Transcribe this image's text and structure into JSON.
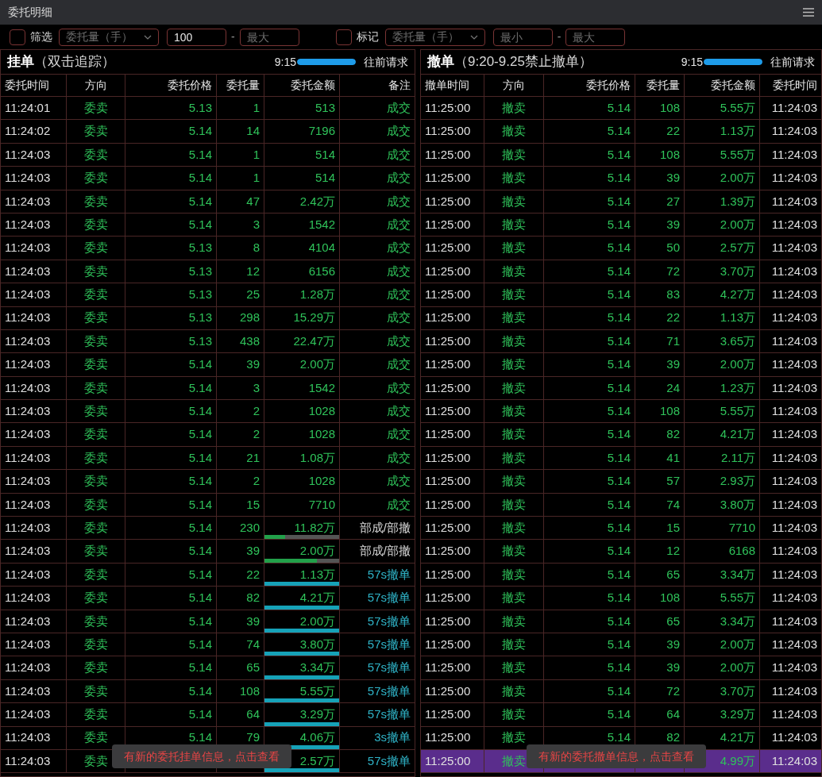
{
  "window": {
    "title": "委托明细"
  },
  "filters": [
    {
      "label": "筛选",
      "checked": false,
      "dropdown": "委托量（手）",
      "min": {
        "value": "100"
      },
      "separator": "-",
      "max": {
        "placeholder": "最大"
      }
    },
    {
      "label": "标记",
      "checked": false,
      "dropdown": "委托量（手）",
      "min": {
        "placeholder": "最小"
      },
      "separator": "-",
      "max": {
        "placeholder": "最大"
      }
    }
  ],
  "panels": [
    {
      "title": "挂单",
      "subtitle": "（双击追踪）",
      "time": "9:15",
      "level": 1,
      "request": "往前请求",
      "columns": [
        "委托时间",
        "方向",
        "委托价格",
        "委托量",
        "委托金额",
        "备注"
      ],
      "toast": "有新的委托挂单信息，点击查看",
      "rows": [
        {
          "cells": [
            "11:24:01",
            "委卖",
            "5.13",
            "1",
            "513",
            "成交"
          ],
          "kind": "filled",
          "selected": false
        },
        {
          "cells": [
            "11:24:02",
            "委卖",
            "5.14",
            "14",
            "7196",
            "成交"
          ],
          "kind": "filled",
          "selected": false
        },
        {
          "cells": [
            "11:24:03",
            "委卖",
            "5.14",
            "1",
            "514",
            "成交"
          ],
          "kind": "filled",
          "selected": false
        },
        {
          "cells": [
            "11:24:03",
            "委卖",
            "5.14",
            "1",
            "514",
            "成交"
          ],
          "kind": "filled",
          "selected": false
        },
        {
          "cells": [
            "11:24:03",
            "委卖",
            "5.14",
            "47",
            "2.42万",
            "成交"
          ],
          "kind": "filled",
          "selected": false
        },
        {
          "cells": [
            "11:24:03",
            "委卖",
            "5.14",
            "3",
            "1542",
            "成交"
          ],
          "kind": "filled",
          "selected": false
        },
        {
          "cells": [
            "11:24:03",
            "委卖",
            "5.13",
            "8",
            "4104",
            "成交"
          ],
          "kind": "filled",
          "selected": false
        },
        {
          "cells": [
            "11:24:03",
            "委卖",
            "5.13",
            "12",
            "6156",
            "成交"
          ],
          "kind": "filled",
          "selected": false
        },
        {
          "cells": [
            "11:24:03",
            "委卖",
            "5.13",
            "25",
            "1.28万",
            "成交"
          ],
          "kind": "filled",
          "selected": false
        },
        {
          "cells": [
            "11:24:03",
            "委卖",
            "5.13",
            "298",
            "15.29万",
            "成交"
          ],
          "kind": "filled",
          "selected": false
        },
        {
          "cells": [
            "11:24:03",
            "委卖",
            "5.13",
            "438",
            "22.47万",
            "成交"
          ],
          "kind": "filled",
          "selected": false
        },
        {
          "cells": [
            "11:24:03",
            "委卖",
            "5.14",
            "39",
            "2.00万",
            "成交"
          ],
          "kind": "filled",
          "selected": false
        },
        {
          "cells": [
            "11:24:03",
            "委卖",
            "5.14",
            "3",
            "1542",
            "成交"
          ],
          "kind": "filled",
          "selected": false
        },
        {
          "cells": [
            "11:24:03",
            "委卖",
            "5.14",
            "2",
            "1028",
            "成交"
          ],
          "kind": "filled",
          "selected": false
        },
        {
          "cells": [
            "11:24:03",
            "委卖",
            "5.14",
            "2",
            "1028",
            "成交"
          ],
          "kind": "filled",
          "selected": false
        },
        {
          "cells": [
            "11:24:03",
            "委卖",
            "5.14",
            "21",
            "1.08万",
            "成交"
          ],
          "kind": "filled",
          "selected": false
        },
        {
          "cells": [
            "11:24:03",
            "委卖",
            "5.14",
            "2",
            "1028",
            "成交"
          ],
          "kind": "filled",
          "selected": false
        },
        {
          "cells": [
            "11:24:03",
            "委卖",
            "5.14",
            "15",
            "7710",
            "成交"
          ],
          "kind": "filled",
          "selected": false
        },
        {
          "cells": [
            "11:24:03",
            "委卖",
            "5.14",
            "230",
            "11.82万",
            "部成/部撤"
          ],
          "kind": "partial",
          "level": 0.28,
          "selected": false
        },
        {
          "cells": [
            "11:24:03",
            "委卖",
            "5.14",
            "39",
            "2.00万",
            "部成/部撤"
          ],
          "kind": "partial",
          "level": 0.7,
          "selected": false
        },
        {
          "cells": [
            "11:24:03",
            "委卖",
            "5.14",
            "22",
            "1.13万",
            "57s撤单"
          ],
          "kind": "cancel",
          "level": 1,
          "selected": false
        },
        {
          "cells": [
            "11:24:03",
            "委卖",
            "5.14",
            "82",
            "4.21万",
            "57s撤单"
          ],
          "kind": "cancel",
          "level": 1,
          "selected": false
        },
        {
          "cells": [
            "11:24:03",
            "委卖",
            "5.14",
            "39",
            "2.00万",
            "57s撤单"
          ],
          "kind": "cancel",
          "level": 1,
          "selected": false
        },
        {
          "cells": [
            "11:24:03",
            "委卖",
            "5.14",
            "74",
            "3.80万",
            "57s撤单"
          ],
          "kind": "cancel",
          "level": 1,
          "selected": false
        },
        {
          "cells": [
            "11:24:03",
            "委卖",
            "5.14",
            "65",
            "3.34万",
            "57s撤单"
          ],
          "kind": "cancel",
          "level": 1,
          "selected": false
        },
        {
          "cells": [
            "11:24:03",
            "委卖",
            "5.14",
            "108",
            "5.55万",
            "57s撤单"
          ],
          "kind": "cancel",
          "level": 1,
          "selected": false
        },
        {
          "cells": [
            "11:24:03",
            "委卖",
            "5.14",
            "64",
            "3.29万",
            "57s撤单"
          ],
          "kind": "cancel",
          "level": 1,
          "selected": false
        },
        {
          "cells": [
            "11:24:03",
            "委卖",
            "5.14",
            "79",
            "4.06万",
            "3s撤单"
          ],
          "kind": "cancel",
          "level": 1,
          "selected": false
        },
        {
          "cells": [
            "11:24:03",
            "委卖",
            null,
            null,
            "2.57万",
            "57s撤单"
          ],
          "kind": "cancel",
          "level": 1,
          "selected": false
        }
      ]
    },
    {
      "title": "撤单",
      "subtitle": "（9:20-9.25禁止撤单）",
      "time": "9:15",
      "level": 1,
      "request": "往前请求",
      "columns": [
        "撤单时间",
        "方向",
        "委托价格",
        "委托量",
        "委托金额",
        "委托时间"
      ],
      "toast": "有新的委托撤单信息，点击查看",
      "rows": [
        {
          "cells": [
            "11:25:00",
            "撤卖",
            "5.14",
            "108",
            "5.55万",
            "11:24:03"
          ],
          "selected": false
        },
        {
          "cells": [
            "11:25:00",
            "撤卖",
            "5.14",
            "22",
            "1.13万",
            "11:24:03"
          ],
          "selected": false
        },
        {
          "cells": [
            "11:25:00",
            "撤卖",
            "5.14",
            "108",
            "5.55万",
            "11:24:03"
          ],
          "selected": false
        },
        {
          "cells": [
            "11:25:00",
            "撤卖",
            "5.14",
            "39",
            "2.00万",
            "11:24:03"
          ],
          "selected": false
        },
        {
          "cells": [
            "11:25:00",
            "撤卖",
            "5.14",
            "27",
            "1.39万",
            "11:24:03"
          ],
          "selected": false
        },
        {
          "cells": [
            "11:25:00",
            "撤卖",
            "5.14",
            "39",
            "2.00万",
            "11:24:03"
          ],
          "selected": false
        },
        {
          "cells": [
            "11:25:00",
            "撤卖",
            "5.14",
            "50",
            "2.57万",
            "11:24:03"
          ],
          "selected": false
        },
        {
          "cells": [
            "11:25:00",
            "撤卖",
            "5.14",
            "72",
            "3.70万",
            "11:24:03"
          ],
          "selected": false
        },
        {
          "cells": [
            "11:25:00",
            "撤卖",
            "5.14",
            "83",
            "4.27万",
            "11:24:03"
          ],
          "selected": false
        },
        {
          "cells": [
            "11:25:00",
            "撤卖",
            "5.14",
            "22",
            "1.13万",
            "11:24:03"
          ],
          "selected": false
        },
        {
          "cells": [
            "11:25:00",
            "撤卖",
            "5.14",
            "71",
            "3.65万",
            "11:24:03"
          ],
          "selected": false
        },
        {
          "cells": [
            "11:25:00",
            "撤卖",
            "5.14",
            "39",
            "2.00万",
            "11:24:03"
          ],
          "selected": false
        },
        {
          "cells": [
            "11:25:00",
            "撤卖",
            "5.14",
            "24",
            "1.23万",
            "11:24:03"
          ],
          "selected": false
        },
        {
          "cells": [
            "11:25:00",
            "撤卖",
            "5.14",
            "108",
            "5.55万",
            "11:24:03"
          ],
          "selected": false
        },
        {
          "cells": [
            "11:25:00",
            "撤卖",
            "5.14",
            "82",
            "4.21万",
            "11:24:03"
          ],
          "selected": false
        },
        {
          "cells": [
            "11:25:00",
            "撤卖",
            "5.14",
            "41",
            "2.11万",
            "11:24:03"
          ],
          "selected": false
        },
        {
          "cells": [
            "11:25:00",
            "撤卖",
            "5.14",
            "57",
            "2.93万",
            "11:24:03"
          ],
          "selected": false
        },
        {
          "cells": [
            "11:25:00",
            "撤卖",
            "5.14",
            "74",
            "3.80万",
            "11:24:03"
          ],
          "selected": false
        },
        {
          "cells": [
            "11:25:00",
            "撤卖",
            "5.14",
            "15",
            "7710",
            "11:24:03"
          ],
          "selected": false
        },
        {
          "cells": [
            "11:25:00",
            "撤卖",
            "5.14",
            "12",
            "6168",
            "11:24:03"
          ],
          "selected": false
        },
        {
          "cells": [
            "11:25:00",
            "撤卖",
            "5.14",
            "65",
            "3.34万",
            "11:24:03"
          ],
          "selected": false
        },
        {
          "cells": [
            "11:25:00",
            "撤卖",
            "5.14",
            "108",
            "5.55万",
            "11:24:03"
          ],
          "selected": false
        },
        {
          "cells": [
            "11:25:00",
            "撤卖",
            "5.14",
            "65",
            "3.34万",
            "11:24:03"
          ],
          "selected": false
        },
        {
          "cells": [
            "11:25:00",
            "撤卖",
            "5.14",
            "39",
            "2.00万",
            "11:24:03"
          ],
          "selected": false
        },
        {
          "cells": [
            "11:25:00",
            "撤卖",
            "5.14",
            "39",
            "2.00万",
            "11:24:03"
          ],
          "selected": false
        },
        {
          "cells": [
            "11:25:00",
            "撤卖",
            "5.14",
            "72",
            "3.70万",
            "11:24:03"
          ],
          "selected": false
        },
        {
          "cells": [
            "11:25:00",
            "撤卖",
            "5.14",
            "64",
            "3.29万",
            "11:24:03"
          ],
          "selected": false
        },
        {
          "cells": [
            "11:25:00",
            "撤卖",
            "5.14",
            "82",
            "4.21万",
            "11:24:03"
          ],
          "selected": false
        },
        {
          "cells": [
            "11:25:00",
            "撤卖",
            null,
            null,
            "4.99万",
            "11:24:03"
          ],
          "selected": true
        }
      ]
    }
  ]
}
